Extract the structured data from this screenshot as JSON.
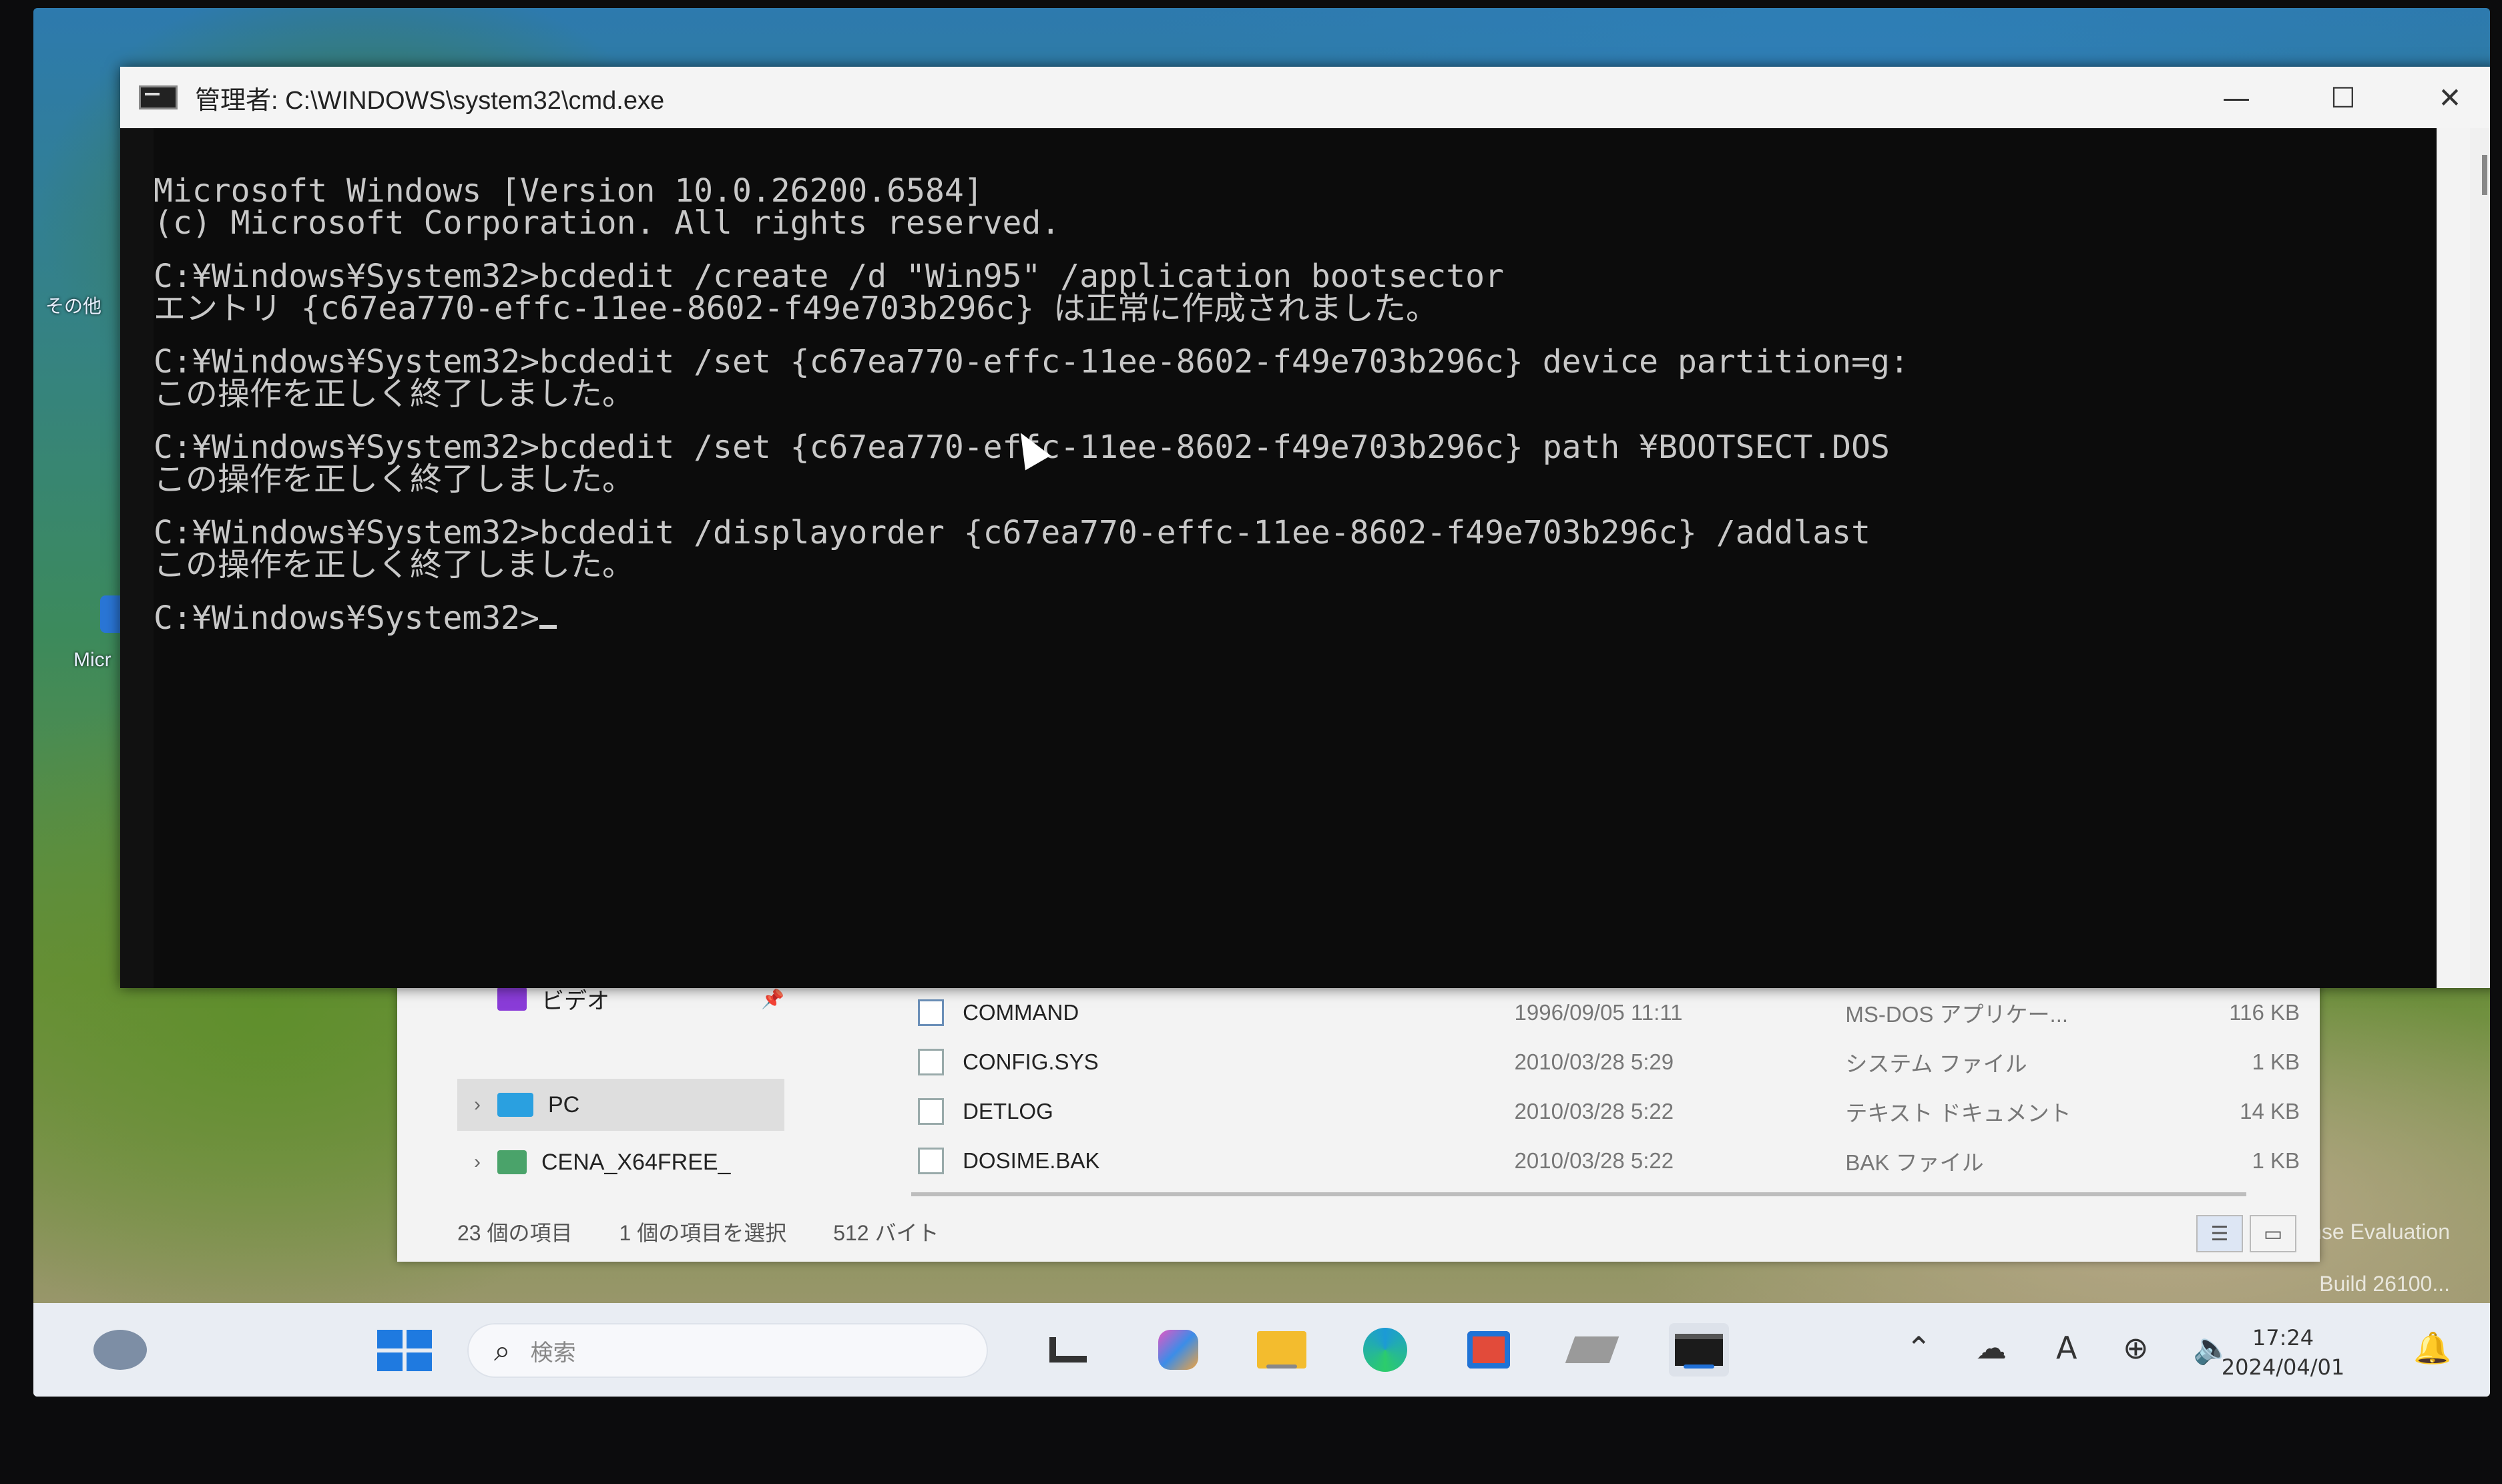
{
  "desktop": {
    "icon_label_1": "Micr",
    "icon_label_2": "その他",
    "watermark_line1": "nse Evaluation",
    "watermark_line2": "Build 26100..."
  },
  "cmd_window": {
    "title": "管理者: C:\\WINDOWS\\system32\\cmd.exe",
    "minimize": "—",
    "maximize": "☐",
    "close": "✕",
    "console_lines": [
      "Microsoft Windows [Version 10.0.26200.6584]",
      "(c) Microsoft Corporation. All rights reserved.",
      "",
      "C:¥Windows¥System32>bcdedit /create /d \"Win95\" /application bootsector",
      "エントリ {c67ea770-effc-11ee-8602-f49e703b296c} は正常に作成されました。",
      "",
      "C:¥Windows¥System32>bcdedit /set {c67ea770-effc-11ee-8602-f49e703b296c} device partition=g:",
      "この操作を正しく終了しました。",
      "",
      "C:¥Windows¥System32>bcdedit /set {c67ea770-effc-11ee-8602-f49e703b296c} path ¥BOOTSECT.DOS",
      "この操作を正しく終了しました。",
      "",
      "C:¥Windows¥System32>bcdedit /displayorder {c67ea770-effc-11ee-8602-f49e703b296c} /addlast",
      "この操作を正しく終了しました。",
      "",
      "C:¥Windows¥System32>"
    ]
  },
  "explorer": {
    "nav_items": [
      {
        "label": "ビデオ",
        "color": "#8a3cd8"
      },
      {
        "label": "PC",
        "color": "#2aa0e0"
      },
      {
        "label": "CENA_X64FREE_",
        "color": "#4aa36a"
      }
    ],
    "files": [
      {
        "name": "COMMAND",
        "date": "1996/09/05 11:11",
        "type": "MS-DOS アプリケー...",
        "size": "116 KB"
      },
      {
        "name": "CONFIG.SYS",
        "date": "2010/03/28 5:29",
        "type": "システム ファイル",
        "size": "1 KB"
      },
      {
        "name": "DETLOG",
        "date": "2010/03/28 5:22",
        "type": "テキスト ドキュメント",
        "size": "14 KB"
      },
      {
        "name": "DOSIME.BAK",
        "date": "2010/03/28 5:22",
        "type": "BAK ファイル",
        "size": "1 KB"
      }
    ],
    "status": {
      "count": "23 個の項目",
      "selection": "1 個の項目を選択",
      "size": "512 バイト"
    }
  },
  "taskbar": {
    "search_placeholder": "検索",
    "clock_time": "17:24",
    "clock_date": "2024/04/01",
    "ime_label": "A",
    "accent": "#1f6fd6"
  }
}
